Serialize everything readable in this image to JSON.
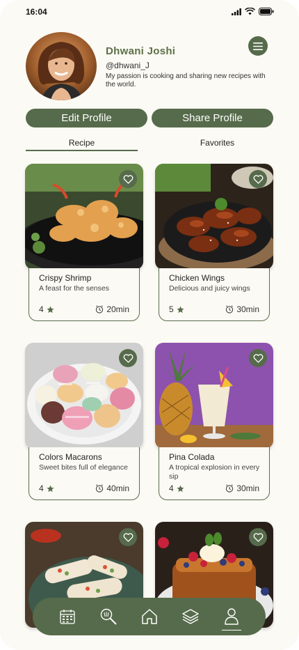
{
  "status": {
    "time": "16:04"
  },
  "profile": {
    "name": "Dhwani Joshi",
    "handle": "@dhwani_J",
    "bio": "My passion is cooking and sharing new recipes with the world."
  },
  "actions": {
    "edit_label": "Edit Profile",
    "share_label": "Share Profile"
  },
  "tabs": {
    "recipe": "Recipe",
    "favorites": "Favorites"
  },
  "recipes": [
    {
      "title": "Crispy Shrimp",
      "desc": "A feast for the senses",
      "rating": "4",
      "time": "20min"
    },
    {
      "title": "Chicken Wings",
      "desc": "Delicious and juicy wings",
      "rating": "5",
      "time": "30min"
    },
    {
      "title": "Colors Macarons",
      "desc": "Sweet bites full of elegance",
      "rating": "4",
      "time": "40min"
    },
    {
      "title": "Pina Colada",
      "desc": "A tropical explosion in every sip",
      "rating": "4",
      "time": "30min"
    }
  ],
  "colors": {
    "accent": "#566b4b",
    "background": "#fbfaf4"
  },
  "icons": {
    "nav": [
      "calendar-icon",
      "search-recipe-icon",
      "home-icon",
      "layers-icon",
      "profile-icon"
    ],
    "card": [
      "heart-icon",
      "star-icon",
      "clock-icon"
    ]
  }
}
